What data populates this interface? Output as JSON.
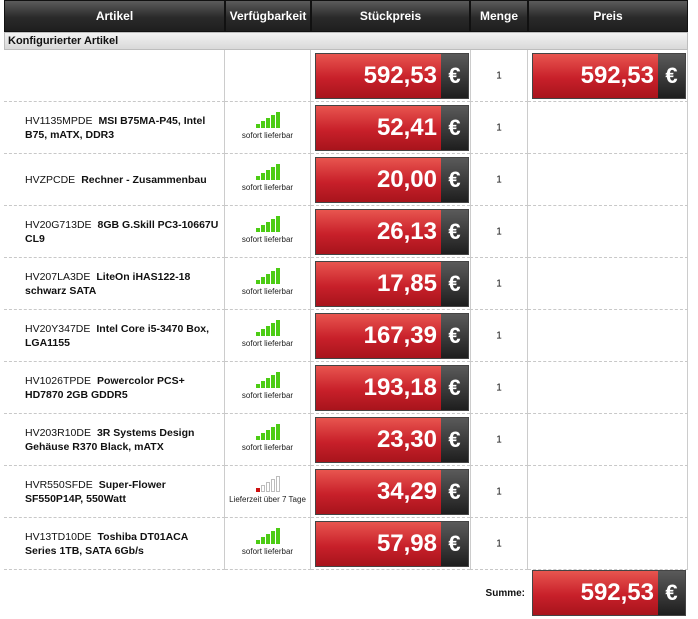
{
  "headers": {
    "artikel": "Artikel",
    "verfuegbarkeit": "Verfügbarkeit",
    "stueckpreis": "Stückpreis",
    "menge": "Menge",
    "preis": "Preis"
  },
  "section_label": "Konfigurierter Artikel",
  "configured": {
    "unit_price": "592,53",
    "quantity": "1",
    "total_price": "592,53"
  },
  "currency_symbol": "€",
  "colors": {
    "available": "#4ccc14",
    "delayed": "#cc1111",
    "inactive": "#bdbdbd"
  },
  "items": [
    {
      "code": "HV1135MPDE",
      "name": "MSI B75MA-P45, Intel B75, mATX, DDR3",
      "availability": "sofort lieferbar",
      "bars_filled": 5,
      "status": "available",
      "unit_price": "52,41",
      "quantity": "1"
    },
    {
      "code": "HVZPCDE",
      "name": "Rechner - Zusammenbau",
      "availability": "sofort lieferbar",
      "bars_filled": 5,
      "status": "available",
      "unit_price": "20,00",
      "quantity": "1"
    },
    {
      "code": "HV20G713DE",
      "name": "8GB G.Skill PC3-10667U CL9",
      "availability": "sofort lieferbar",
      "bars_filled": 5,
      "status": "available",
      "unit_price": "26,13",
      "quantity": "1"
    },
    {
      "code": "HV207LA3DE",
      "name": "LiteOn iHAS122-18 schwarz SATA",
      "availability": "sofort lieferbar",
      "bars_filled": 5,
      "status": "available",
      "unit_price": "17,85",
      "quantity": "1"
    },
    {
      "code": "HV20Y347DE",
      "name": "Intel Core i5-3470 Box, LGA1155",
      "availability": "sofort lieferbar",
      "bars_filled": 5,
      "status": "available",
      "unit_price": "167,39",
      "quantity": "1"
    },
    {
      "code": "HV1026TPDE",
      "name": "Powercolor PCS+ HD7870 2GB GDDR5",
      "availability": "sofort lieferbar",
      "bars_filled": 5,
      "status": "available",
      "unit_price": "193,18",
      "quantity": "1"
    },
    {
      "code": "HV203R10DE",
      "name": "3R Systems Design Gehäuse R370 Black, mATX",
      "availability": "sofort lieferbar",
      "bars_filled": 5,
      "status": "available",
      "unit_price": "23,30",
      "quantity": "1"
    },
    {
      "code": "HVR550SFDE",
      "name": "Super-Flower SF550P14P, 550Watt",
      "availability": "Lieferzeit über 7 Tage",
      "bars_filled": 1,
      "status": "delayed",
      "unit_price": "34,29",
      "quantity": "1"
    },
    {
      "code": "HV13TD10DE",
      "name": "Toshiba DT01ACA Series 1TB, SATA 6Gb/s",
      "availability": "sofort lieferbar",
      "bars_filled": 5,
      "status": "available",
      "unit_price": "57,98",
      "quantity": "1"
    }
  ],
  "summary": {
    "label": "Summe:",
    "total": "592,53"
  }
}
